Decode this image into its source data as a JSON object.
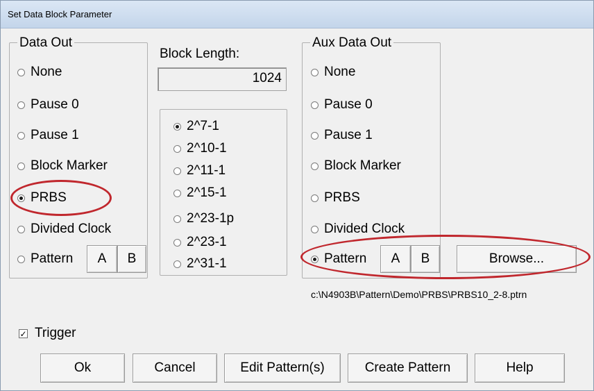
{
  "window": {
    "title": "Set Data Block Parameter"
  },
  "data_out": {
    "label": "Data Out",
    "options": [
      {
        "label": "None",
        "checked": false
      },
      {
        "label": "Pause 0",
        "checked": false
      },
      {
        "label": "Pause 1",
        "checked": false
      },
      {
        "label": "Block Marker",
        "checked": false
      },
      {
        "label": "PRBS",
        "checked": true
      },
      {
        "label": "Divided Clock",
        "checked": false
      },
      {
        "label": "Pattern",
        "checked": false
      }
    ],
    "pattern_a": "A",
    "pattern_b": "B"
  },
  "block_length": {
    "label": "Block Length:",
    "value": "1024"
  },
  "prbs": {
    "options": [
      {
        "label": "2^7-1",
        "checked": true
      },
      {
        "label": "2^10-1",
        "checked": false
      },
      {
        "label": "2^11-1",
        "checked": false
      },
      {
        "label": "2^15-1",
        "checked": false
      },
      {
        "label": "2^23-1p",
        "checked": false
      },
      {
        "label": "2^23-1",
        "checked": false
      },
      {
        "label": "2^31-1",
        "checked": false
      }
    ]
  },
  "aux_data_out": {
    "label": "Aux Data Out",
    "options": [
      {
        "label": "None",
        "checked": false
      },
      {
        "label": "Pause 0",
        "checked": false
      },
      {
        "label": "Pause 1",
        "checked": false
      },
      {
        "label": "Block Marker",
        "checked": false
      },
      {
        "label": "PRBS",
        "checked": false
      },
      {
        "label": "Divided Clock",
        "checked": false
      },
      {
        "label": "Pattern",
        "checked": true
      }
    ],
    "pattern_a": "A",
    "pattern_b": "B",
    "browse_label": "Browse...",
    "file_path": "c:\\N4903B\\Pattern\\Demo\\PRBS\\PRBS10_2-8.ptrn"
  },
  "trigger": {
    "label": "Trigger",
    "checked": true
  },
  "buttons": {
    "ok": "Ok",
    "cancel": "Cancel",
    "edit_patterns": "Edit Pattern(s)",
    "create_pattern": "Create Pattern",
    "help": "Help"
  },
  "colors": {
    "annotation": "#c0272d",
    "background": "#f0f0f0"
  }
}
